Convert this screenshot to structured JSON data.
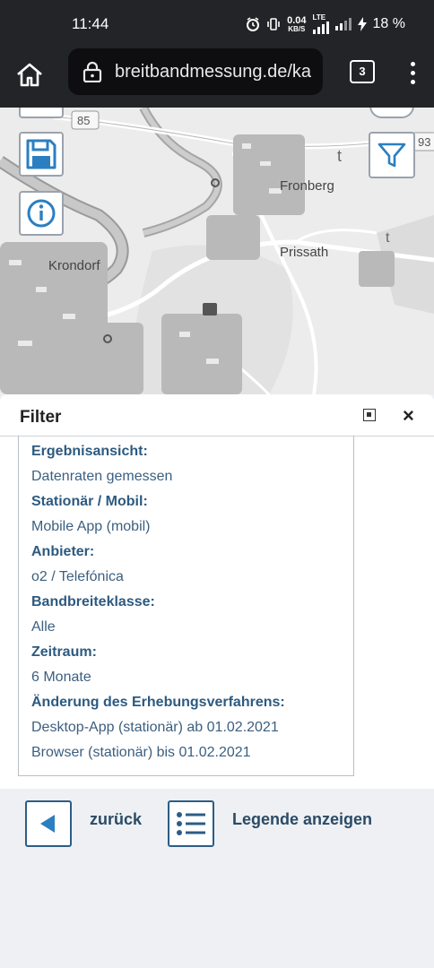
{
  "status_bar": {
    "time": "11:44",
    "net_speed": "0.04",
    "net_unit": "KB/S",
    "network": "LTE",
    "battery": "18 %"
  },
  "browser": {
    "url": "breitbandmessung.de/ka",
    "tab_count": "3"
  },
  "map": {
    "places": [
      "Fronberg",
      "Krondorf",
      "Prissath"
    ],
    "road_numbers": [
      "85",
      "93"
    ]
  },
  "panel": {
    "title": "Filter",
    "close_symbol": "×",
    "items": [
      {
        "label": "Ergebnisansicht:",
        "value": "Datenraten gemessen"
      },
      {
        "label": "Stationär / Mobil:",
        "value": "Mobile App (mobil)"
      },
      {
        "label": "Anbieter:",
        "value": "o2 / Telefónica"
      },
      {
        "label": "Bandbreiteklasse:",
        "value": "Alle"
      },
      {
        "label": "Zeitraum:",
        "value": "6 Monate"
      },
      {
        "label": "Änderung des Erhebungsverfahrens:",
        "value": "Desktop-App (stationär) ab 01.02.2021",
        "value2": "Browser (stationär) bis 01.02.2021"
      }
    ]
  },
  "nav": {
    "back_label": "zurück",
    "legend_label": "Legende anzeigen"
  }
}
